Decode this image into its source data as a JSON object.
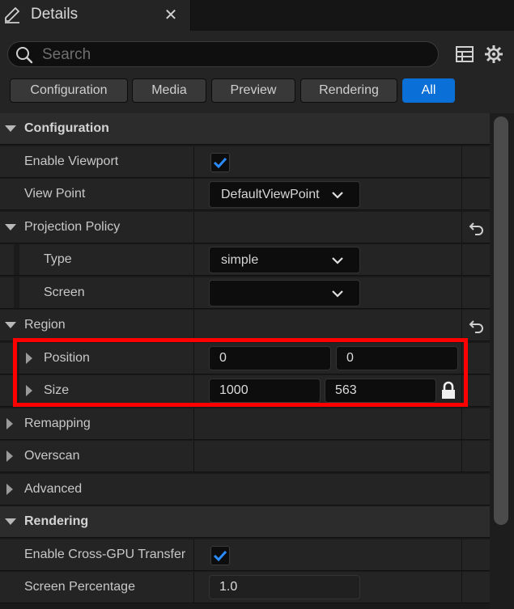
{
  "tab": {
    "title": "Details",
    "close_glyph": "✕",
    "icon": "pencil-icon"
  },
  "search": {
    "placeholder": "Search",
    "value": ""
  },
  "toolbar_icons": [
    "table-view-icon",
    "gear-icon"
  ],
  "filters": [
    {
      "label": "Configuration",
      "active": false
    },
    {
      "label": "Media",
      "active": false
    },
    {
      "label": "Preview",
      "active": false
    },
    {
      "label": "Rendering",
      "active": false
    },
    {
      "label": "All",
      "active": true
    }
  ],
  "rows": {
    "configuration": "Configuration",
    "enable_viewport": {
      "label": "Enable Viewport",
      "checked": true
    },
    "view_point": {
      "label": "View Point",
      "value": "DefaultViewPoint"
    },
    "projection_policy": "Projection Policy",
    "type": {
      "label": "Type",
      "value": "simple"
    },
    "screen": {
      "label": "Screen",
      "value": ""
    },
    "region": "Region",
    "position": {
      "label": "Position",
      "x": "0",
      "y": "0"
    },
    "size": {
      "label": "Size",
      "w": "1000",
      "h": "563"
    },
    "remapping": "Remapping",
    "overscan": "Overscan",
    "advanced": "Advanced",
    "rendering": "Rendering",
    "enable_cross_gpu": {
      "label": "Enable Cross-GPU Transfer",
      "checked": true
    },
    "screen_percentage": {
      "label": "Screen Percentage",
      "value": "1.0"
    }
  },
  "colors": {
    "accent": "#0a6fd6",
    "highlight": "#ff0000",
    "check": "#2a8cff"
  }
}
